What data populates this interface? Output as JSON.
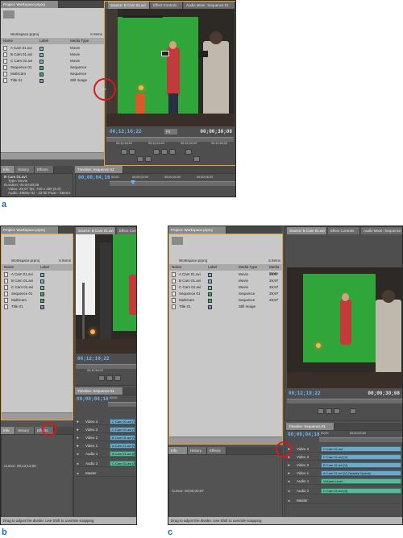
{
  "figure_labels": {
    "a": "a",
    "b": "b",
    "c": "c"
  },
  "project": {
    "tab": "Project: Workspace.prproj",
    "name": "Workspace.prproj",
    "count": "6 Items",
    "columns": {
      "name": "Name",
      "label": "Label",
      "media_type": "Media Type",
      "media_start": "Media Start"
    },
    "items": [
      {
        "name": "A Cam 01.avi",
        "media_type": "Movie",
        "start": "29;97",
        "color": "#6fc0b8"
      },
      {
        "name": "B Cam 01.avi",
        "media_type": "Movie",
        "start": "29;97",
        "color": "#6fc0b8"
      },
      {
        "name": "C Cam 01.avi",
        "media_type": "Movie",
        "start": "29;97",
        "color": "#6fc0b8"
      },
      {
        "name": "Sequence 01",
        "media_type": "Sequence",
        "start": "29;97",
        "color": "#3fae6b"
      },
      {
        "name": "MultiCam",
        "media_type": "Sequence",
        "start": "29;97",
        "color": "#3fae6b"
      },
      {
        "name": "Title 01",
        "media_type": "Still Image",
        "start": "",
        "color": "#8a8ad8"
      }
    ]
  },
  "monitor": {
    "tabs": [
      "Source: B Cam 01.avi",
      "Effect Controls",
      "Audio Mixer: Sequence 01"
    ],
    "timecode_in": "00;12;10;22",
    "timecode_out": "00;00;30;08",
    "fit": "Fit",
    "ruler_marks": [
      "00;12;16;22",
      "00;12;24;22",
      "00;12;32;22",
      "00;12;40;22",
      "00;12;48"
    ]
  },
  "info": {
    "tabs": [
      "Info",
      "History",
      "Effects"
    ],
    "clip_name": "B Cam 01.avi",
    "lines": [
      "Type: Movie",
      "Duration: 00;00;30;08",
      "Video: 29.97 fps, 720 x 480 (0.9)",
      "Audio: 48000 Hz - 32-bit Float - Stereo"
    ],
    "cursor_b": "Cursor: 00;12;12;06",
    "cursor_c": "Cursor: 00;00;00;07"
  },
  "timeline": {
    "tab": "Timeline: Sequence 01",
    "timecode": "00;00;04;16",
    "ruler_start": "00;00",
    "ruler_marks": [
      "00;00;02;00",
      "00;00;04;00",
      "00;00;06;00"
    ],
    "video_tracks": [
      "Video 4",
      "Video 3",
      "Video 2",
      "Video 1"
    ],
    "audio_tracks": [
      "Audio 1",
      "Audio 2",
      "Master"
    ],
    "clips": {
      "c_cam_v": "C Cam 01.avi [V]",
      "c_cam_short": "C Cam 01.avi",
      "b_cam_v": "B Cam 01.avi [V]",
      "a_cam_v": "A Cam 01.avi [V]",
      "a_cam_opacity": "A Cam 01.avi [V]  Opacity:Opacity",
      "a_cam_a": "A Cam 01.avi [A]",
      "volume": "Volume:Level",
      "c_cam_a": "C Cam 01.avi [A]"
    }
  },
  "status_text": "Drag to adjust the divider. Use Shift to override snapping",
  "colors": {
    "focus": "#e3a43a",
    "timecode": "#6fb6ff",
    "circle": "#d41b1b",
    "letter": "#1f6db5"
  }
}
